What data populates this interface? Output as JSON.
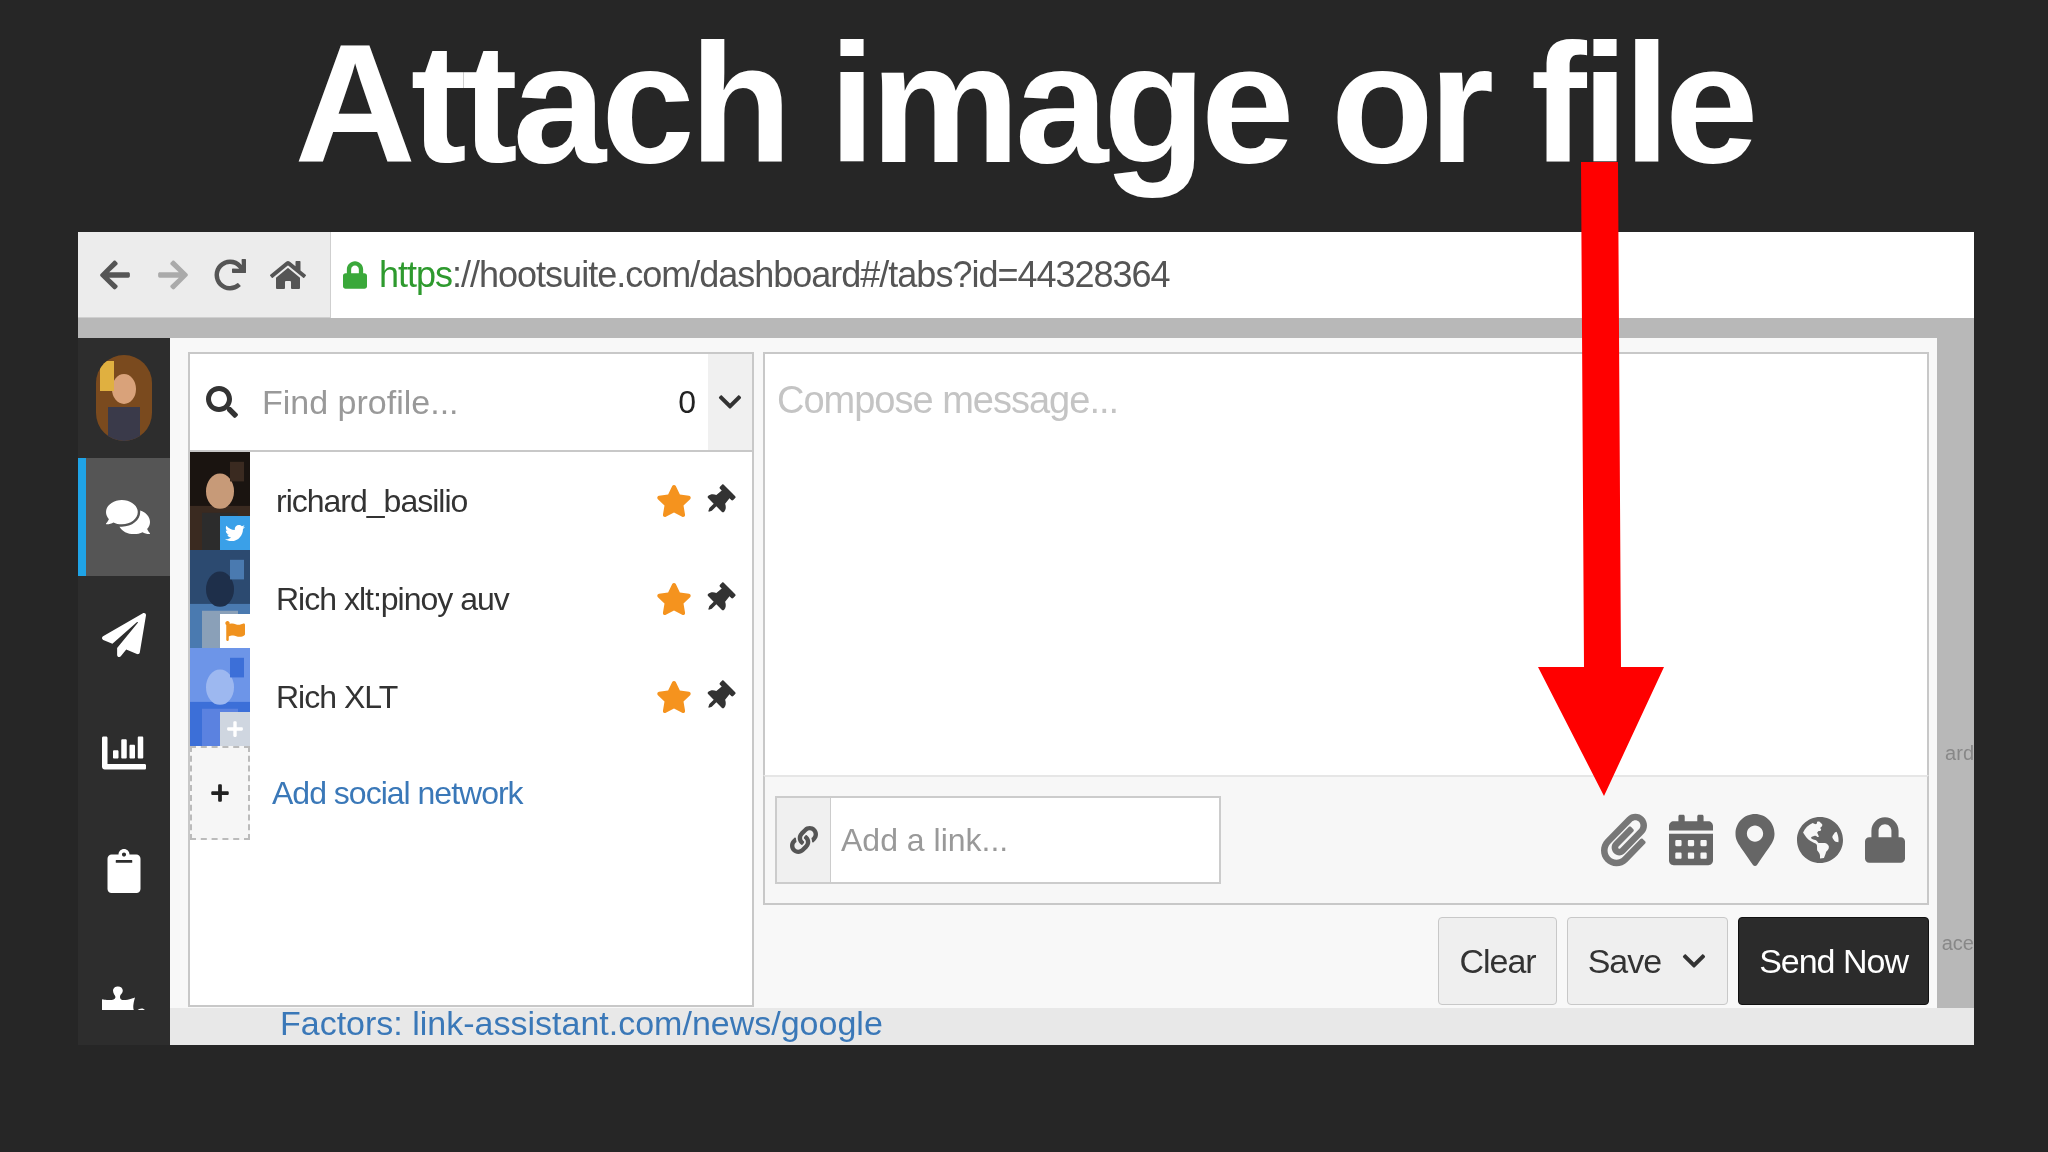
{
  "headline": "Attach image or file",
  "browser": {
    "url_scheme": "https",
    "url_rest": "://hootsuite.com/dashboard#/tabs?id=44328364"
  },
  "sidebar": {
    "items": [
      {
        "kind": "avatar",
        "selected": false
      },
      {
        "kind": "streams",
        "selected": true
      },
      {
        "kind": "publisher",
        "selected": false
      },
      {
        "kind": "analytics",
        "selected": false
      },
      {
        "kind": "assignments",
        "selected": false
      },
      {
        "kind": "apps",
        "selected": false
      }
    ]
  },
  "profile_picker": {
    "placeholder": "Find profile...",
    "count": "0",
    "profiles": [
      {
        "name": "richard_basilio",
        "kind": "twitter",
        "favorite": true
      },
      {
        "name": "Rich xlt:pinoy auv",
        "kind": "page",
        "favorite": true
      },
      {
        "name": "Rich XLT",
        "kind": "google",
        "favorite": true
      }
    ],
    "add_link": "Add social network"
  },
  "composer": {
    "placeholder": "Compose message...",
    "link_placeholder": "Add a link...",
    "buttons": [
      {
        "label": "Clear",
        "kind": "plain"
      },
      {
        "label": "Save",
        "kind": "menu"
      },
      {
        "label": "Send Now",
        "kind": "primary"
      }
    ]
  },
  "background": {
    "bottom_text": "Factors: link-assistant.com/news/google",
    "right_fragments": [
      "ard",
      "ace"
    ]
  }
}
